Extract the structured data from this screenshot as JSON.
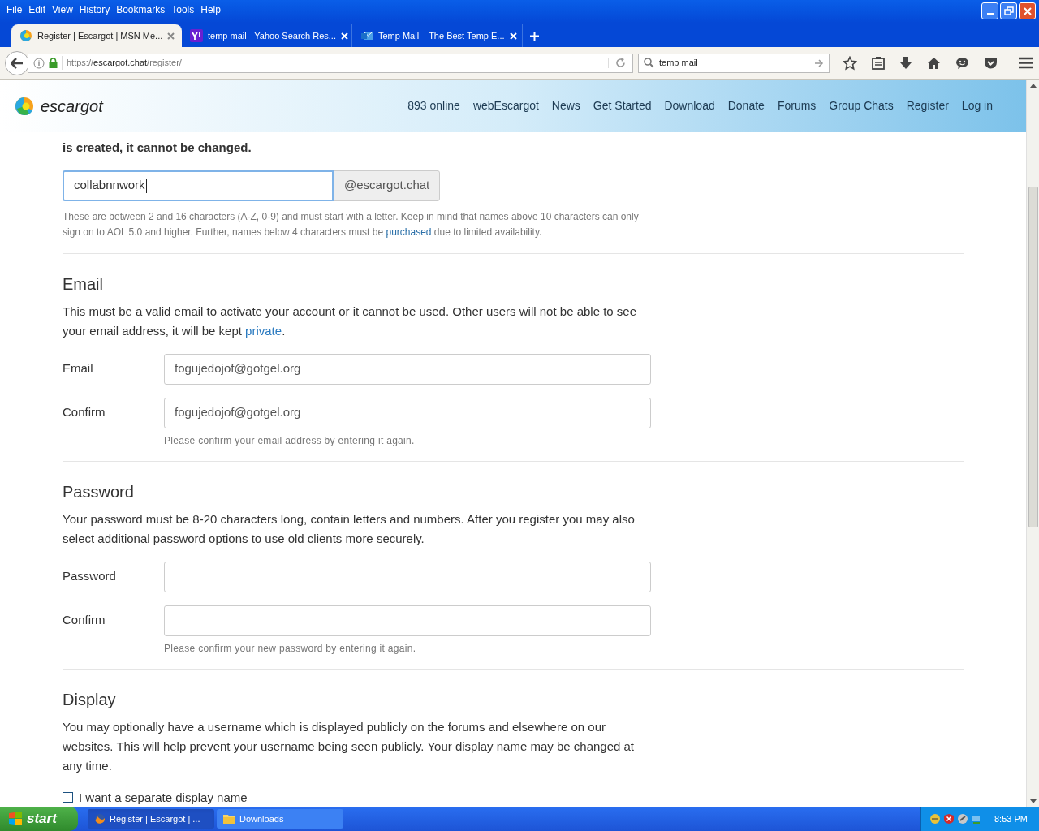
{
  "menu": [
    "File",
    "Edit",
    "View",
    "History",
    "Bookmarks",
    "Tools",
    "Help"
  ],
  "tabs": [
    {
      "title": "Register | Escargot | MSN Me...",
      "selected": true
    },
    {
      "title": "temp mail - Yahoo Search Res...",
      "selected": false
    },
    {
      "title": "Temp Mail – The Best Temp E...",
      "selected": false
    }
  ],
  "address": {
    "scheme": "https://",
    "host": "escargot.chat",
    "path": "/register/"
  },
  "search": {
    "value": "temp mail"
  },
  "site": {
    "logo": "escargot",
    "nav": [
      "893 online",
      "webEscargot",
      "News",
      "Get Started",
      "Download",
      "Donate",
      "Forums",
      "Group Chats",
      "Register",
      "Log in"
    ]
  },
  "username": {
    "intro": "is created, it cannot be changed.",
    "value": "collabnnwork",
    "suffix": "@escargot.chat",
    "help_before": "These are between 2 and 16 characters (A-Z, 0-9) and must start with a letter. Keep in mind that names above 10 characters can only sign on to AOL 5.0 and higher. Further, names below 4 characters must be ",
    "help_link": "purchased",
    "help_after": " due to limited availability."
  },
  "sections": [
    {
      "heading": "Email",
      "text_before": "This must be a valid email to activate your account or it cannot be used. Other users will not be able to see your email address, it will be kept ",
      "link": "private",
      "text_after": ".",
      "fields": [
        {
          "label": "Email",
          "value": "fogujedojof@gotgel.org"
        },
        {
          "label": "Confirm",
          "value": "fogujedojof@gotgel.org"
        }
      ],
      "hint": "Please confirm your email address by entering it again."
    },
    {
      "heading": "Password",
      "text_before": "Your password must be 8-20 characters long, contain letters and numbers. After you register you may also select additional password options to use old clients more securely.",
      "fields": [
        {
          "label": "Password"
        },
        {
          "label": "Confirm"
        }
      ],
      "hint": "Please confirm your new password by entering it again."
    },
    {
      "heading": "Display",
      "text_before": "You may optionally have a username which is displayed publicly on the forums and elsewhere on our websites. This will help prevent your username being seen publicly. Your display name may be changed at any time.",
      "checkbox": {
        "label": "I want a separate display name",
        "checked": false
      }
    }
  ],
  "taskbar": {
    "start": "start",
    "tasks": [
      {
        "label": "Register | Escargot | ...",
        "selected": true
      },
      {
        "label": "Downloads",
        "selected": false
      }
    ],
    "clock": "8:53 PM"
  }
}
